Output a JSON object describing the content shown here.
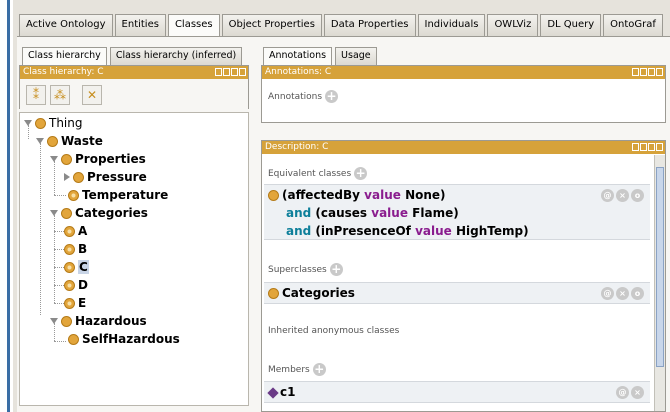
{
  "main_tabs": [
    "Active Ontology",
    "Entities",
    "Classes",
    "Object Properties",
    "Data Properties",
    "Individuals",
    "OWLViz",
    "DL Query",
    "OntoGraf"
  ],
  "left": {
    "tabs": [
      "Class hierarchy",
      "Class hierarchy (inferred)"
    ],
    "panel_title": "Class hierarchy: C",
    "tree": [
      {
        "label": "Thing",
        "bold": false
      },
      {
        "label": "Waste",
        "bold": true
      },
      {
        "label": "Properties",
        "bold": true
      },
      {
        "label": "Pressure",
        "bold": true
      },
      {
        "label": "Temperature",
        "bold": true
      },
      {
        "label": "Categories",
        "bold": true
      },
      {
        "label": "A",
        "bold": true
      },
      {
        "label": "B",
        "bold": true
      },
      {
        "label": "C",
        "bold": true,
        "selected": true
      },
      {
        "label": "D",
        "bold": true
      },
      {
        "label": "E",
        "bold": true
      },
      {
        "label": "Hazardous",
        "bold": true
      },
      {
        "label": "SelfHazardous",
        "bold": true
      }
    ]
  },
  "right": {
    "tabs": [
      "Annotations",
      "Usage"
    ],
    "annotations_title": "Annotations: C",
    "annotations_label": "Annotations",
    "description_title": "Description: C",
    "equivalent_label": "Equivalent classes",
    "equivalent_expr": {
      "line1_pre": "(affectedBy ",
      "line1_kw": "value",
      "line1_post": " None)",
      "line2_and": "and",
      "line2_pre": " (causes ",
      "line2_kw": "value",
      "line2_post": " Flame)",
      "line3_and": "and",
      "line3_pre": " (inPresenceOf ",
      "line3_kw": "value",
      "line3_post": " HighTemp)"
    },
    "superclasses_label": "Superclasses",
    "superclass": "Categories",
    "inherited_label": "Inherited anonymous classes",
    "members_label": "Members",
    "member": "c1"
  },
  "colors": {
    "accent": "#d6a23a",
    "keyword_and": "#0d7f9a",
    "keyword_value": "#8a1c8e",
    "class_icon": "#e2a53b"
  }
}
